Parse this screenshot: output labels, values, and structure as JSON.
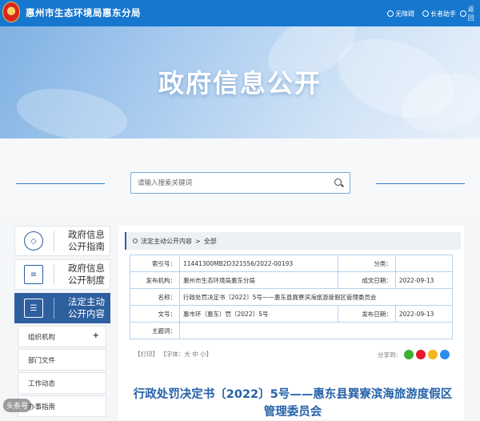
{
  "header": {
    "site_name": "惠州市生态环境局惠东分局",
    "tools": [
      "无障碍",
      "长者助手",
      "返回"
    ]
  },
  "banner": {
    "title": "政府信息公开"
  },
  "search": {
    "placeholder": "请输入搜索关键词",
    "value": ""
  },
  "sidebar": {
    "items": [
      {
        "label": "政府信息公开指南",
        "icon": "compass-icon",
        "active": false
      },
      {
        "label": "政府信息公开制度",
        "icon": "list-icon",
        "active": false
      },
      {
        "label": "法定主动公开内容",
        "icon": "document-icon",
        "active": true
      }
    ],
    "submenu": [
      {
        "label": "组织机构",
        "expandable": true
      },
      {
        "label": "部门文件",
        "expandable": false
      },
      {
        "label": "工作动态",
        "expandable": false
      },
      {
        "label": "办事指南",
        "expandable": false
      }
    ]
  },
  "breadcrumb": {
    "items": [
      "法定主动公开内容",
      ">",
      "全部"
    ]
  },
  "meta": {
    "index_label": "索引号：",
    "index_value": "11441300MB2D321556/2022-00193",
    "category_label": "分类：",
    "category_value": "",
    "publisher_label": "发布机构：",
    "publisher_value": "惠州市生态环境局惠东分局",
    "date_label": "成文日期：",
    "date_value": "2022-09-13",
    "name_label": "名称：",
    "name_value": "行政处罚决定书〔2022〕5号——惠东县巽寮滨海旅游度假区管理委员会",
    "docno_label": "文号：",
    "docno_value": "惠市环（惠东）罚〔2022〕5号",
    "pubdate_label": "发布日期：",
    "pubdate_value": "2022-09-13",
    "topic_label": "主题词：",
    "topic_value": ""
  },
  "toolbar": {
    "print": "【打印】",
    "font": "【字体：大 中 小】",
    "share_label": "分享到："
  },
  "document": {
    "title": "行政处罚决定书〔2022〕5号——惠东县巽寮滨海旅游度假区管理委员会"
  },
  "watermark": "头条号"
}
